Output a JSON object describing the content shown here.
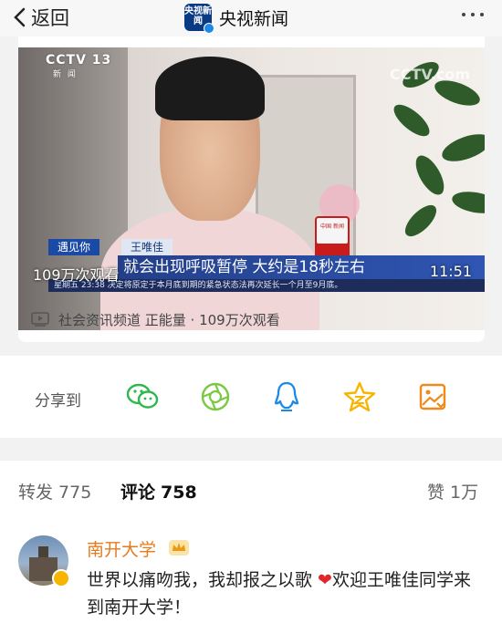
{
  "header": {
    "back_label": "返回",
    "logo_text": "央视新闻",
    "account_name": "央视新闻"
  },
  "video": {
    "channel_logo": "CCTV 13",
    "channel_sub": "新 闻",
    "watermark": "CCTV.com",
    "lower_third_tag": "遇见你",
    "lower_third_name": "王唯佳",
    "subtitle": "就会出现呼吸暂停 大约是18秒左右",
    "ticker": "星期五 23:38 决定将原定于本月底到期的紧急状态法再次延长一个月至9月底。",
    "mic_label": "中国 新闻",
    "views_overlay": "109万次观看",
    "duration": "11:51"
  },
  "meta": {
    "text": "社会资讯频道 正能量 · 109万次观看"
  },
  "share": {
    "label": "分享到",
    "targets": [
      "wechat-icon",
      "moments-icon",
      "qq-icon",
      "qzone-icon",
      "save-icon"
    ]
  },
  "tabs": {
    "repost_label": "转发",
    "repost_count": "775",
    "comment_label": "评论",
    "comment_count": "758",
    "like_label": "赞",
    "like_count": "1万"
  },
  "comment": {
    "author": "南开大学",
    "text_before": "世界以痛吻我，我却报之以歌 ",
    "heart": "❤",
    "text_after": "欢迎王唯佳同学来到南开大学！"
  },
  "colors": {
    "accent_orange": "#e87a1e",
    "share_green": "#2db84d",
    "share_blue": "#1e88e5",
    "share_yellow": "#f7b500",
    "share_orange": "#f08a1c"
  }
}
